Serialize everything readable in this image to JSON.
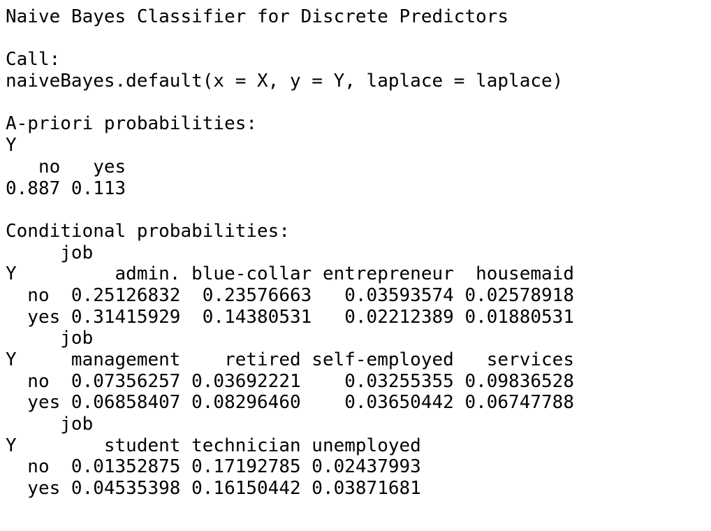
{
  "console": {
    "lines": [
      "Naive Bayes Classifier for Discrete Predictors",
      "",
      "Call:",
      "naiveBayes.default(x = X, y = Y, laplace = laplace)",
      "",
      "A-priori probabilities:",
      "Y",
      "   no   yes ",
      "0.887 0.113 ",
      "",
      "Conditional probabilities:",
      "     job",
      "Y         admin. blue-collar entrepreneur  housemaid",
      "  no  0.25126832  0.23576663   0.03593574 0.02578918",
      "  yes 0.31415929  0.14380531   0.02212389 0.01880531",
      "     job",
      "Y     management    retired self-employed   services",
      "  no  0.07356257 0.03692221    0.03255355 0.09836528",
      "  yes 0.06858407 0.08296460    0.03650442 0.06747788",
      "     job",
      "Y        student technician unemployed",
      "  no  0.01352875 0.17192785 0.02437993",
      "  yes 0.04535398 0.16150442 0.03871681"
    ]
  }
}
